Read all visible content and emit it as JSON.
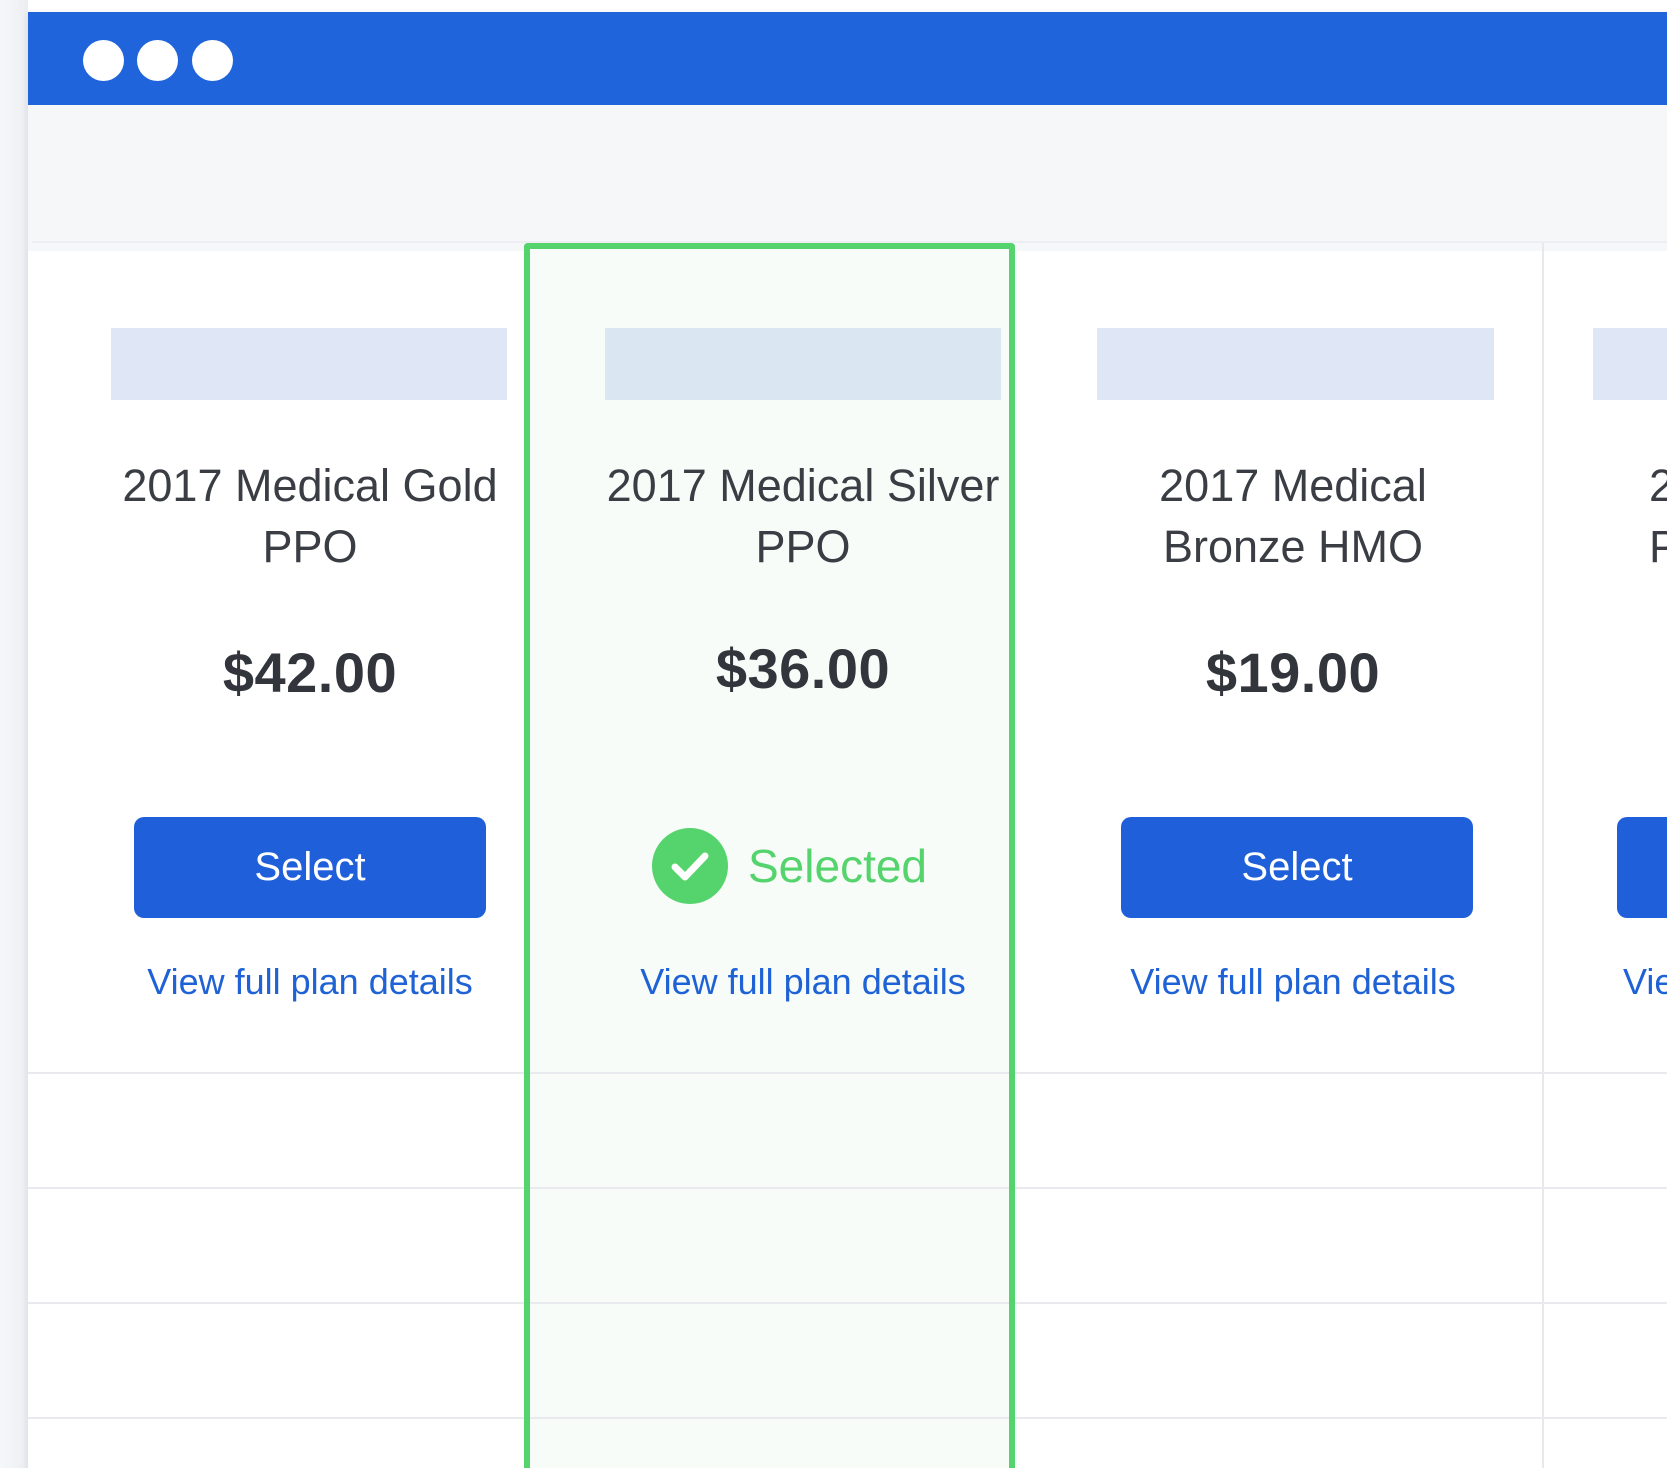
{
  "window": {
    "controls": [
      "close",
      "minimize",
      "maximize"
    ]
  },
  "colors": {
    "titlebar": "#2064dc",
    "button": "#1f60da",
    "link": "#1f62d6",
    "selected_accent": "#55d36c",
    "placeholder": "#dfe6f5"
  },
  "plans": [
    {
      "name_line1": "2017 Medical Gold",
      "name_line2": "PPO",
      "price": "$42.00",
      "action_label": "Select",
      "details_label": "View full plan details"
    },
    {
      "name_line1": "2017 Medical Silver",
      "name_line2": "PPO",
      "price": "$36.00",
      "status_label": "Selected",
      "status_icon": "check-icon",
      "details_label": "View full plan details"
    },
    {
      "name_line1": "2017 Medical",
      "name_line2": "Bronze HMO",
      "price": "$19.00",
      "action_label": "Select",
      "details_label": "View full plan details"
    },
    {
      "name_line1": "2",
      "name_line2": "P",
      "details_label": "Vie"
    }
  ]
}
